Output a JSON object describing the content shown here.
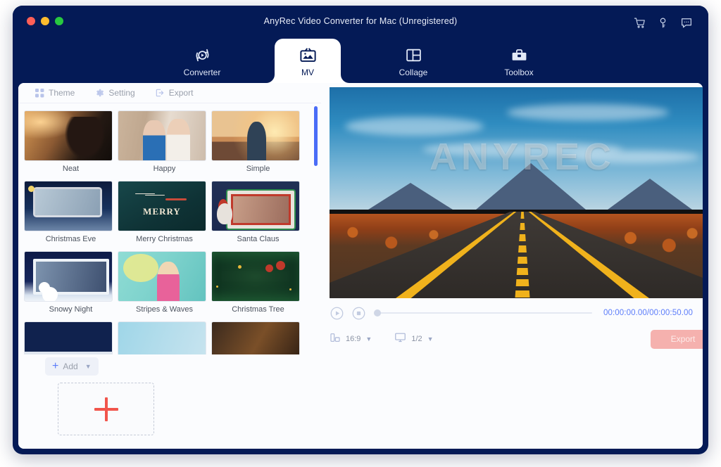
{
  "window": {
    "title": "AnyRec Video Converter for Mac (Unregistered)",
    "traffic_lights": [
      "close",
      "minimize",
      "maximize"
    ],
    "title_icons": [
      "cart-icon",
      "key-icon",
      "chat-icon"
    ],
    "border_color": "#041a56"
  },
  "nav": {
    "tabs": [
      {
        "label": "Converter",
        "icon": "converter-icon",
        "active": false
      },
      {
        "label": "MV",
        "icon": "mv-icon",
        "active": true
      },
      {
        "label": "Collage",
        "icon": "collage-icon",
        "active": false
      },
      {
        "label": "Toolbox",
        "icon": "toolbox-icon",
        "active": false
      }
    ]
  },
  "subtabs": [
    {
      "label": "Theme",
      "icon": "grid-icon"
    },
    {
      "label": "Setting",
      "icon": "gear-icon"
    },
    {
      "label": "Export",
      "icon": "export-icon"
    }
  ],
  "themes": [
    {
      "name": "Neat",
      "art": "art-neat"
    },
    {
      "name": "Happy",
      "art": "art-happy"
    },
    {
      "name": "Simple",
      "art": "art-simple"
    },
    {
      "name": "Christmas Eve",
      "art": "art-xmaseve"
    },
    {
      "name": "Merry Christmas",
      "art": "art-merryx"
    },
    {
      "name": "Santa Claus",
      "art": "art-santa"
    },
    {
      "name": "Snowy Night",
      "art": "art-snowy"
    },
    {
      "name": "Stripes & Waves",
      "art": "art-stripes"
    },
    {
      "name": "Christmas Tree",
      "art": "art-xtree"
    }
  ],
  "add": {
    "label": "Add",
    "plus": "+",
    "chevron": "▼",
    "dropzone_icon": "plus-icon"
  },
  "preview": {
    "watermark": "ANYREC",
    "scene": "desert-road"
  },
  "player": {
    "play_icon": "play-circle-icon",
    "stop_icon": "stop-circle-icon",
    "progress_percent": 0,
    "current_time": "00:00:00.00",
    "total_time": "00:00:50.00",
    "timecode": "00:00:00.00/00:00:50.00",
    "volume_icon": "volume-icon",
    "aspect_ratio": "16:9",
    "aspect_icon": "aspect-ratio-icon",
    "screen_scale": "1/2",
    "screen_icon": "monitor-icon",
    "chevron": "▼",
    "export_label": "Export",
    "export_color": "#f5b1ae"
  },
  "colors": {
    "navy": "#041a56",
    "accent_blue": "#4a6cf7",
    "timecode_blue": "#5b7cfa",
    "export_pink": "#f5b1ae",
    "dropzone_red": "#f1554c"
  }
}
